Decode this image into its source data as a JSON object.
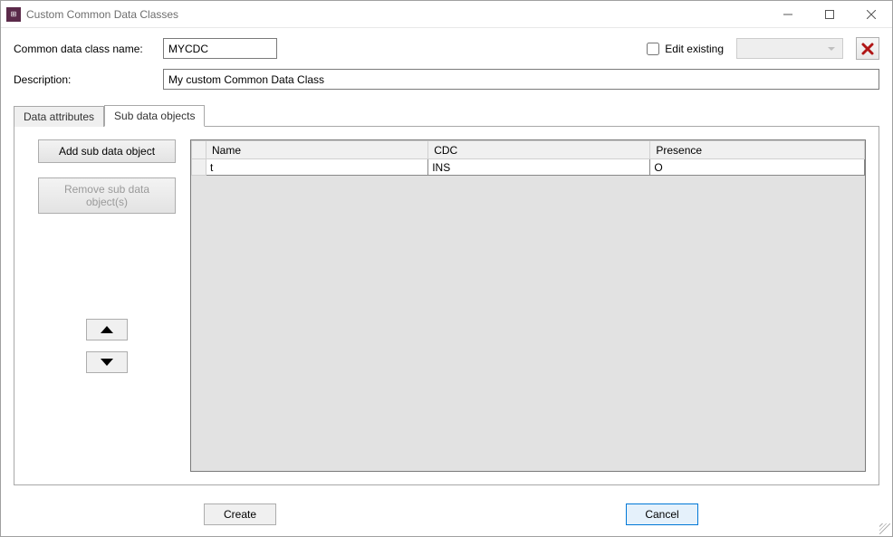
{
  "window": {
    "title": "Custom Common Data Classes"
  },
  "form": {
    "name_label": "Common data class name:",
    "name_value": "MYCDC",
    "edit_existing_label": "Edit existing",
    "desc_label": "Description:",
    "desc_value": "My custom Common Data Class"
  },
  "tabs": {
    "data_attributes": "Data attributes",
    "sub_data_objects": "Sub data objects"
  },
  "buttons": {
    "add_sub": "Add sub data object",
    "remove_sub": "Remove sub data object(s)",
    "create": "Create",
    "cancel": "Cancel"
  },
  "table": {
    "headers": {
      "name": "Name",
      "cdc": "CDC",
      "presence": "Presence"
    },
    "rows": [
      {
        "name": "t",
        "cdc": "INS",
        "presence": "O"
      }
    ]
  }
}
